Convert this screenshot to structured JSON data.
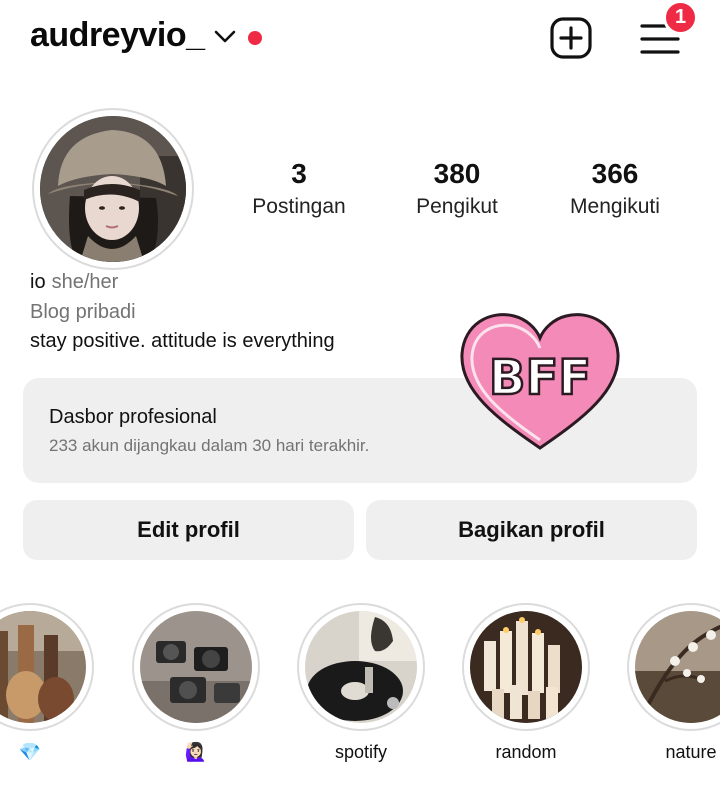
{
  "header": {
    "username": "audreyvio_",
    "notification_count": "1"
  },
  "stats": [
    {
      "count": "3",
      "label": "Postingan"
    },
    {
      "count": "380",
      "label": "Pengikut"
    },
    {
      "count": "366",
      "label": "Mengikuti"
    }
  ],
  "bio": {
    "name": "io",
    "pronouns": "she/her",
    "category": "Blog pribadi",
    "text": "stay positive. attitude is everything"
  },
  "dashboard": {
    "title": "Dasbor profesional",
    "subtitle": "233 akun dijangkau dalam 30 hari terakhir."
  },
  "sticker": {
    "text": "BFF"
  },
  "buttons": {
    "edit": "Edit profil",
    "share": "Bagikan profil"
  },
  "highlights": [
    {
      "label": "💎"
    },
    {
      "label": "🙋🏻‍♀️"
    },
    {
      "label": "spotify"
    },
    {
      "label": "random"
    },
    {
      "label": "nature"
    }
  ],
  "colors": {
    "accent_red": "#ee2a45",
    "button_bg": "#efefef",
    "muted_text": "#737373",
    "sticker_pink": "#f48ab8"
  },
  "icons": [
    "chevron-down-icon",
    "new-post-icon",
    "menu-icon"
  ]
}
